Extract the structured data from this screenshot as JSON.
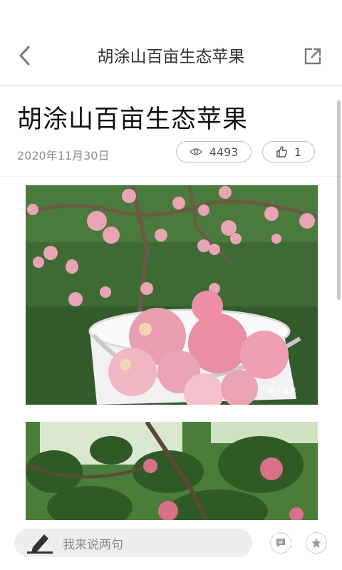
{
  "nav": {
    "title": "胡涂山百亩生态苹果",
    "back_icon": "chevron-left-icon",
    "share_icon": "share-icon"
  },
  "article": {
    "title": "胡涂山百亩生态苹果",
    "date": "2020年11月30日",
    "views": "4493",
    "likes": "1",
    "images": [
      {
        "alt": "apples in a bucket",
        "watermark": "农工富民"
      },
      {
        "alt": "apple tree"
      }
    ]
  },
  "bottom": {
    "comment_placeholder": "我来说两句",
    "pen_icon": "pen-icon",
    "message_icon": "message-icon",
    "star_icon": "star-icon"
  },
  "colors": {
    "divider": "#d9d9d9",
    "pill_border": "#bdbdbd",
    "input_bg": "#eeeeee",
    "apple_pink": "#e9a5b5",
    "foliage_green": "#3e6b34"
  }
}
